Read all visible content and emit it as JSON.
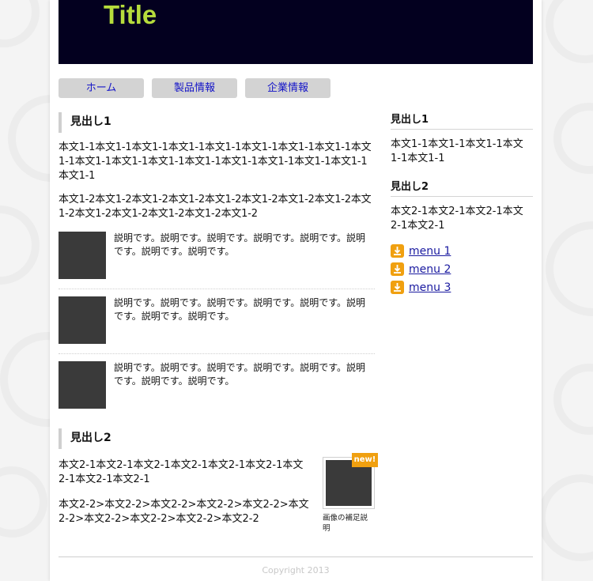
{
  "header": {
    "logo": "Title"
  },
  "nav": [
    {
      "label": "ホーム"
    },
    {
      "label": "製品情報"
    },
    {
      "label": "企業情報"
    }
  ],
  "main": {
    "section1": {
      "heading": "見出し1",
      "para1": "本文1-1本文1-1本文1-1本文1-1本文1-1本文1-1本文1-1本文1-1本文1-1本文1-1本文1-1本文1-1本文1-1本文1-1本文1-1本文1-1本文1-1本文1-1",
      "para2": "本文1-2本文1-2本文1-2本文1-2本文1-2本文1-2本文1-2本文1-2本文1-2本文1-2本文1-2本文1-2本文1-2本文1-2",
      "items": [
        {
          "desc": "説明です。説明です。説明です。説明です。説明です。説明です。説明です。説明です。"
        },
        {
          "desc": "説明です。説明です。説明です。説明です。説明です。説明です。説明です。説明です。"
        },
        {
          "desc": "説明です。説明です。説明です。説明です。説明です。説明です。説明です。説明です。"
        }
      ]
    },
    "section2": {
      "heading": "見出し2",
      "para1": "本文2-1本文2-1本文2-1本文2-1本文2-1本文2-1本文2-1本文2-1本文2-1",
      "para2": "本文2-2>本文2-2>本文2-2>本文2-2>本文2-2>本文2-2>本文2-2>本文2-2>本文2-2>本文2-2",
      "badge": "new!",
      "caption": "画像の補足説明"
    }
  },
  "sidebar": {
    "heading1": "見出し1",
    "text1": "本文1-1本文1-1本文1-1本文1-1本文1-1",
    "heading2": "見出し2",
    "text2": "本文2-1本文2-1本文2-1本文2-1本文2-1",
    "menu": [
      {
        "label": "menu 1",
        "icon": "download-icon"
      },
      {
        "label": "menu 2",
        "icon": "download-icon"
      },
      {
        "label": "menu 3",
        "icon": "download-icon"
      }
    ]
  },
  "footer": {
    "copyright": "Copyright 2013"
  },
  "colors": {
    "header_bg": "#03001f",
    "logo": "#b6dc3c",
    "nav_bg": "#d3d3d3",
    "link": "#1414c8",
    "accent": "#f0a010"
  }
}
